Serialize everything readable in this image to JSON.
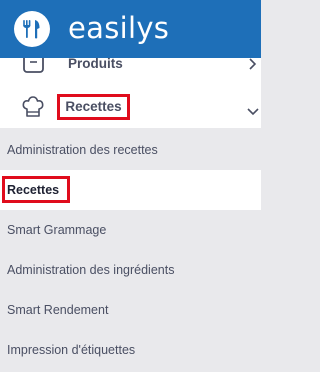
{
  "brand": {
    "name": "easilys",
    "logo_icon": "fork-knife-icon",
    "header_color": "#1e6fb8"
  },
  "menu": {
    "items": [
      {
        "label": "Produits",
        "icon": "box-icon",
        "chevron": "chevron-right-icon"
      },
      {
        "label": "Recettes",
        "icon": "chef-hat-icon",
        "chevron": "chevron-down-icon",
        "expanded": true,
        "highlighted": true
      }
    ],
    "submenu": [
      {
        "label": "Administration des recettes"
      },
      {
        "label": "Recettes",
        "active": true,
        "highlighted": true
      },
      {
        "label": "Smart Grammage"
      },
      {
        "label": "Administration des ingrédients"
      },
      {
        "label": "Smart Rendement"
      },
      {
        "label": "Impression d'étiquettes"
      }
    ]
  },
  "colors": {
    "highlight_border": "#e00c1c",
    "submenu_bg": "#e9e9ec",
    "text": "#4a4f63"
  }
}
